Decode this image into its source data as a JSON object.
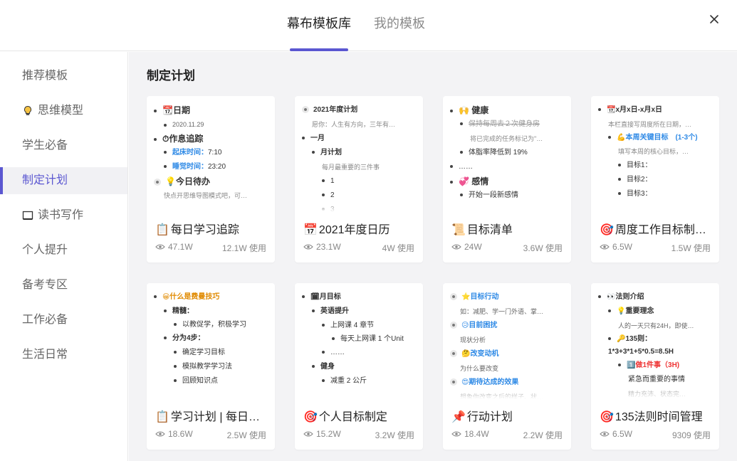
{
  "header": {
    "tabs": [
      {
        "label": "幕布模板库",
        "active": true
      },
      {
        "label": "我的模板",
        "active": false
      }
    ],
    "close_icon": "close-icon",
    "accent_color": "#5b57d1"
  },
  "sidebar": {
    "items": [
      {
        "label": "推荐模板",
        "icon": null,
        "active": false
      },
      {
        "label": "思维模型",
        "icon": "lightbulb-icon",
        "active": false
      },
      {
        "label": "学生必备",
        "icon": null,
        "active": false
      },
      {
        "label": "制定计划",
        "icon": null,
        "active": true
      },
      {
        "label": "读书写作",
        "icon": "book-icon",
        "active": false
      },
      {
        "label": "个人提升",
        "icon": null,
        "active": false
      },
      {
        "label": "备考专区",
        "icon": null,
        "active": false
      },
      {
        "label": "工作必备",
        "icon": null,
        "active": false
      },
      {
        "label": "生活日常",
        "icon": null,
        "active": false
      }
    ]
  },
  "main": {
    "section_title": "制定计划",
    "cards": [
      {
        "title_icon": "📋",
        "title": "每日学习追踪",
        "views": "47.1W",
        "uses": "12.1W 使用",
        "preview": [
          {
            "lvl": 0,
            "b": "dot",
            "t": "📆日期",
            "s": "bold"
          },
          {
            "lvl": 1,
            "b": "dot",
            "t": "2020.11.29",
            "s": "small-dark"
          },
          {
            "lvl": 0,
            "b": "dot",
            "t": "⏱作息追踪",
            "s": "bold"
          },
          {
            "lvl": 1,
            "b": "dot",
            "t": "起床时间：7:10",
            "s": "blue-key"
          },
          {
            "lvl": 1,
            "b": "dot",
            "t": "睡觉时间：23:20",
            "s": "blue-key"
          },
          {
            "lvl": 0,
            "b": "ring",
            "t": "💡今日待办",
            "s": "bold"
          },
          {
            "lvl": 0,
            "b": "none",
            "t": "快点开思维导图模式吧，可…",
            "s": "small"
          }
        ]
      },
      {
        "title_icon": "📅",
        "title": "2021年度日历",
        "views": "23.1W",
        "uses": "4W 使用",
        "preview": [
          {
            "lvl": 0,
            "b": "ring",
            "t": "2021年度计划",
            "s": "semi"
          },
          {
            "lvl": 0,
            "b": "none",
            "t": "愿你：人生有方向，三年有…",
            "s": "small"
          },
          {
            "lvl": 0,
            "b": "dot",
            "t": "一月",
            "s": "semi"
          },
          {
            "lvl": 1,
            "b": "dot",
            "t": "月计划",
            "s": "semi"
          },
          {
            "lvl": 1,
            "b": "none",
            "t": "每月最重要的三件事",
            "s": "small"
          },
          {
            "lvl": 2,
            "b": "dot",
            "t": "1",
            "s": ""
          },
          {
            "lvl": 2,
            "b": "dot",
            "t": "2",
            "s": ""
          },
          {
            "lvl": 2,
            "b": "dot",
            "t": "3",
            "s": ""
          }
        ]
      },
      {
        "title_icon": "📜",
        "title": "目标清单",
        "views": "24W",
        "uses": "3.6W 使用",
        "preview": [
          {
            "lvl": 0,
            "b": "dot",
            "t": "🙌 健康",
            "s": "bold"
          },
          {
            "lvl": 1,
            "b": "dot",
            "t": "保持每周去２次健身房",
            "s": "strike"
          },
          {
            "lvl": 1,
            "b": "none",
            "t": "将已完成的任务标记为\"…",
            "s": "small"
          },
          {
            "lvl": 1,
            "b": "dot",
            "t": "体脂率降低到 19%",
            "s": ""
          },
          {
            "lvl": 0,
            "b": "dot",
            "t": "……",
            "s": ""
          },
          {
            "lvl": 0,
            "b": "dot",
            "t": "💞 感情",
            "s": "bold"
          },
          {
            "lvl": 1,
            "b": "dot",
            "t": "开始一段新感情",
            "s": ""
          }
        ]
      },
      {
        "title_icon": "🎯",
        "title": "周度工作目标制…",
        "views": "6.5W",
        "uses": "1.5W 使用",
        "preview": [
          {
            "lvl": 0,
            "b": "dot",
            "t": "📆x月x日-x月x日",
            "s": "semi"
          },
          {
            "lvl": 0,
            "b": "none",
            "t": "本栏直接写周度所在日期，…",
            "s": "small"
          },
          {
            "lvl": 1,
            "b": "dot",
            "t": "💪本周关键目标　(1-3个)",
            "s": "blue-wrap"
          },
          {
            "lvl": 1,
            "b": "none",
            "t": "填写本周的核心目标，…",
            "s": "small"
          },
          {
            "lvl": 2,
            "b": "dot",
            "t": "目标1：",
            "s": ""
          },
          {
            "lvl": 2,
            "b": "dot",
            "t": "目标2：",
            "s": ""
          },
          {
            "lvl": 2,
            "b": "dot",
            "t": "目标3：",
            "s": ""
          }
        ]
      },
      {
        "title_icon": "📋",
        "title": "学习计划 | 每日…",
        "views": "18.6W",
        "uses": "2.5W 使用",
        "preview": [
          {
            "lvl": 0,
            "b": "dot",
            "t": "😀什么是费曼技巧",
            "s": "orange"
          },
          {
            "lvl": 1,
            "b": "dot",
            "t": "精髓：",
            "s": "semi"
          },
          {
            "lvl": 2,
            "b": "dot",
            "t": "以教促学，积极学习",
            "s": "wrap"
          },
          {
            "lvl": 1,
            "b": "dot",
            "t": "分为4步：",
            "s": "semi"
          },
          {
            "lvl": 2,
            "b": "dot",
            "t": "确定学习目标",
            "s": ""
          },
          {
            "lvl": 2,
            "b": "dot",
            "t": "模拟教学学习法",
            "s": ""
          },
          {
            "lvl": 2,
            "b": "dot",
            "t": "回顾知识点",
            "s": ""
          }
        ]
      },
      {
        "title_icon": "🎯",
        "title": "个人目标制定",
        "views": "15.2W",
        "uses": "3.2W 使用",
        "preview": [
          {
            "lvl": 0,
            "b": "dot",
            "t": "🗓月目标",
            "s": "semi"
          },
          {
            "lvl": 1,
            "b": "dot",
            "t": "英语提升",
            "s": "semi"
          },
          {
            "lvl": 2,
            "b": "dot",
            "t": "上网课 4 章节",
            "s": ""
          },
          {
            "lvl": 3,
            "b": "dot",
            "t": "每天上网课 1 个Unit",
            "s": "wrap"
          },
          {
            "lvl": 2,
            "b": "dot",
            "t": "……",
            "s": ""
          },
          {
            "lvl": 1,
            "b": "dot",
            "t": "健身",
            "s": "semi"
          },
          {
            "lvl": 2,
            "b": "dot",
            "t": "减重 2 公斤",
            "s": ""
          }
        ]
      },
      {
        "title_icon": "📌",
        "title": "行动计划",
        "views": "18.4W",
        "uses": "2.2W 使用",
        "preview": [
          {
            "lvl": 0,
            "b": "ring",
            "t": "⭐目标行动",
            "s": "blue"
          },
          {
            "lvl": 0,
            "b": "none",
            "t": "如：减肥、学一门外语、掌…",
            "s": "small-dark"
          },
          {
            "lvl": 0,
            "b": "ring",
            "t": "😥目前困扰",
            "s": "blue"
          },
          {
            "lvl": 0,
            "b": "none",
            "t": "现状分析",
            "s": "small-dark"
          },
          {
            "lvl": 0,
            "b": "ring",
            "t": "🤔改变动机",
            "s": "blue"
          },
          {
            "lvl": 0,
            "b": "none",
            "t": "为什么要改变",
            "s": "small-dark"
          },
          {
            "lvl": 0,
            "b": "ring",
            "t": "😍期待达成的效果",
            "s": "blue"
          },
          {
            "lvl": 0,
            "b": "none",
            "t": "想象你改变之后的样子、状…",
            "s": "small-dark"
          }
        ]
      },
      {
        "title_icon": "🎯",
        "title": "135法则时间管理",
        "views": "6.5W",
        "uses": "9309 使用",
        "preview": [
          {
            "lvl": 0,
            "b": "dot",
            "t": "👀法则介绍",
            "s": "semi"
          },
          {
            "lvl": 1,
            "b": "dot",
            "t": "💡重要理念",
            "s": "semi"
          },
          {
            "lvl": 1,
            "b": "none",
            "t": "人的一天只有24H，即使…",
            "s": "small-dark"
          },
          {
            "lvl": 1,
            "b": "dot",
            "t": "🔑135则：1*3+3*1+5*0.5=8.5H",
            "s": "semi-wrap"
          },
          {
            "lvl": 2,
            "b": "dot",
            "t": "1️⃣做1件事（3H)",
            "s": "red"
          },
          {
            "lvl": 2,
            "b": "none",
            "t": "紧急而重要的事情",
            "s": ""
          },
          {
            "lvl": 2,
            "b": "none",
            "t": "精力充沛、状态完…",
            "s": "small"
          }
        ]
      }
    ]
  }
}
